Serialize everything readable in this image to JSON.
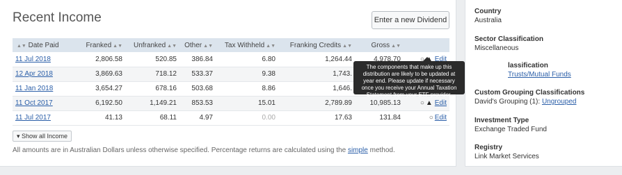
{
  "income": {
    "title": "Recent Income",
    "new_dividend_label": "Enter a new Dividend",
    "columns": [
      "Date Paid",
      "Franked",
      "Unfranked",
      "Other",
      "Tax Withheld",
      "Franking Credits",
      "Gross"
    ],
    "rows": [
      {
        "date": "11 Jul 2018",
        "franked": "2,806.58",
        "unfranked": "520.85",
        "other": "386.84",
        "tax": "6.80",
        "credits": "1,264.44",
        "gross": "4,978.70",
        "edit": "Edit"
      },
      {
        "date": "12 Apr 2018",
        "franked": "3,869.63",
        "unfranked": "718.12",
        "other": "533.37",
        "tax": "9.38",
        "credits": "1,743.",
        "gross": "",
        "edit": ""
      },
      {
        "date": "11 Jan 2018",
        "franked": "3,654.27",
        "unfranked": "678.16",
        "other": "503.68",
        "tax": "8.86",
        "credits": "1,646.",
        "gross": "",
        "edit": ""
      },
      {
        "date": "11 Oct 2017",
        "franked": "6,192.50",
        "unfranked": "1,149.21",
        "other": "853.53",
        "tax": "15.01",
        "credits": "2,789.89",
        "gross": "10,985.13",
        "edit": "Edit"
      },
      {
        "date": "11 Jul 2017",
        "franked": "41.13",
        "unfranked": "68.11",
        "other": "4.97",
        "tax": "0.00",
        "credits": "17.63",
        "gross": "131.84",
        "edit": "Edit"
      }
    ],
    "show_all_label": "▾ Show all Income",
    "footnote_prefix": "All amounts are in Australian Dollars unless otherwise specified. Percentage returns are calculated using the ",
    "footnote_link": "simple",
    "footnote_suffix": " method.",
    "tooltip": "The components that make up this distribution are likely to be updated at year end. Please update if necessary once you receive your Annual Taxation Statement from your ETF provider."
  },
  "sidebar": {
    "country_label": "Country",
    "country_value": "Australia",
    "sector_label": "Sector Classification",
    "sector_value": "Miscellaneous",
    "industry_label": "lassification",
    "industry_value": "Trusts/Mutual Funds",
    "custom_label": "Custom Grouping Classifications",
    "custom_value_prefix": "David's Grouping (1): ",
    "custom_value_link": "Ungrouped",
    "investment_label": "Investment Type",
    "investment_value": "Exchange Traded Fund",
    "registry_label": "Registry",
    "registry_value": "Link Market Services"
  }
}
